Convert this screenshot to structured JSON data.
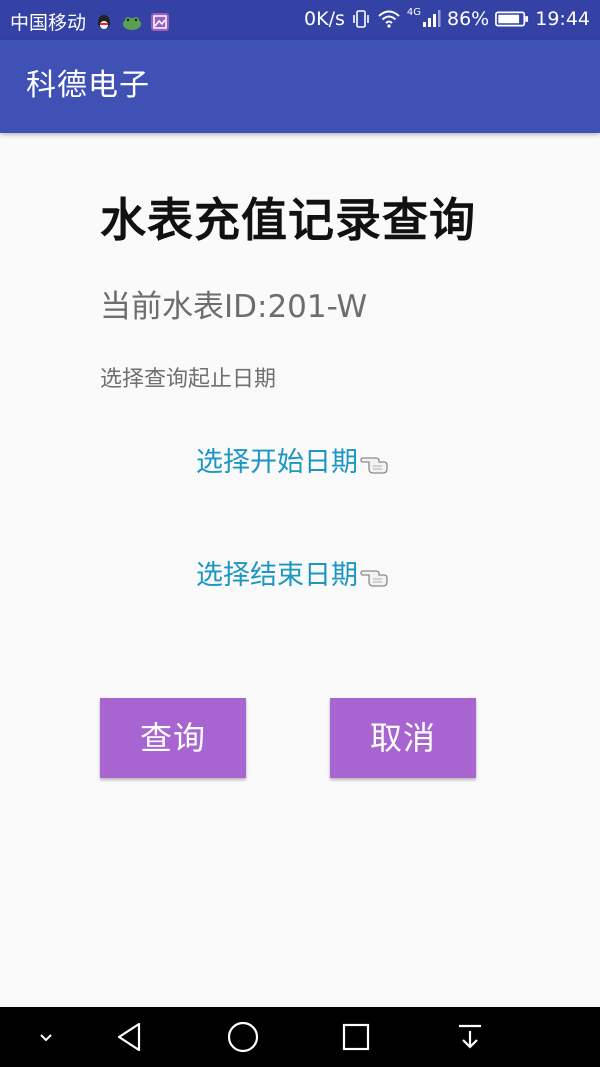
{
  "status_bar": {
    "carrier": "中国移动",
    "speed": "0K/s",
    "network": "4G",
    "battery": "86%",
    "time": "19:44",
    "icons": [
      "qq-icon",
      "frog-app-icon",
      "gallery-icon",
      "vibrate-icon",
      "wifi-icon",
      "signal-icon",
      "battery-icon"
    ]
  },
  "app_bar": {
    "title": "科德电子"
  },
  "main": {
    "title": "水表充值记录查询",
    "meter_label": "当前水表ID:201-W",
    "hint": "选择查询起止日期",
    "start_date_label": "选择开始日期",
    "end_date_label": "选择结束日期",
    "query_button": "查询",
    "cancel_button": "取消"
  },
  "nav_bar": {
    "icons": [
      "collapse-chevron-icon",
      "back-triangle-icon",
      "home-circle-icon",
      "recents-square-icon",
      "notification-pull-icon"
    ]
  },
  "colors": {
    "status_bar": "#3342a4",
    "app_bar": "#3f51b5",
    "link": "#1c97c3",
    "button": "#a864d0"
  }
}
